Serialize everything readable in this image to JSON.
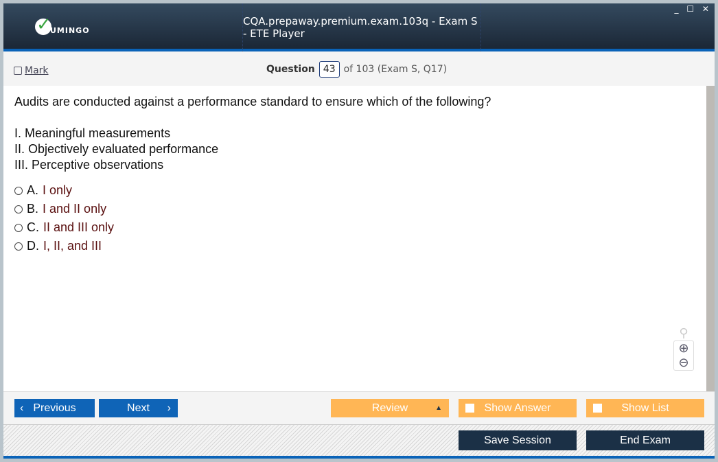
{
  "app": {
    "logo_text": "UMINGO",
    "title": "CQA.prepaway.premium.exam.103q - Exam S - ETE Player",
    "window_controls": "_ ☐ ✕"
  },
  "question_bar": {
    "mark_label": "Mark",
    "question_label": "Question",
    "question_number": "43",
    "of_text": "of 103 (Exam S, Q17)"
  },
  "question": {
    "text": "Audits are conducted against a performance standard to ensure which of the following?",
    "items": [
      "I. Meaningful measurements",
      "II. Objectively evaluated performance",
      "III. Perceptive observations"
    ],
    "options": [
      {
        "letter": "A.",
        "text": "I only"
      },
      {
        "letter": "B.",
        "text": "I and II only"
      },
      {
        "letter": "C.",
        "text": "II and III only"
      },
      {
        "letter": "D.",
        "text": "I, II, and III"
      }
    ]
  },
  "buttons": {
    "previous": "Previous",
    "next": "Next",
    "review": "Review",
    "show_answer": "Show Answer",
    "show_list": "Show List",
    "save_session": "Save Session",
    "end_exam": "End Exam"
  }
}
